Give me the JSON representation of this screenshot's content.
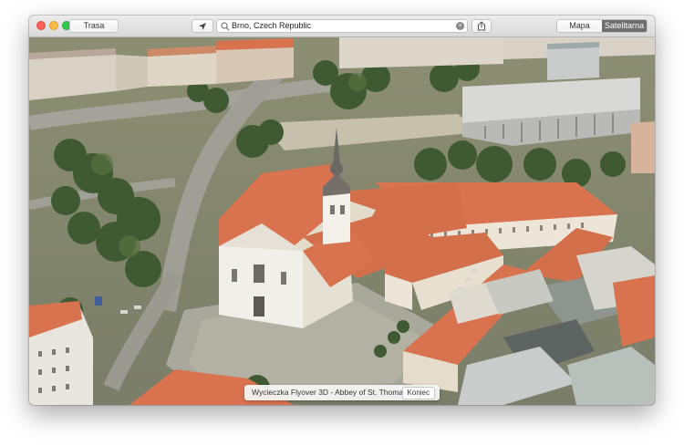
{
  "toolbar": {
    "route_label": "Trasa",
    "locate_icon": "location-arrow-icon",
    "search": {
      "value": "Brno, Czech Republic",
      "icon": "search-icon",
      "clear_icon": "clear-icon"
    },
    "share_icon": "share-icon",
    "view_modes": [
      {
        "label": "Mapa",
        "active": false
      },
      {
        "label": "Satelitarna",
        "active": true
      }
    ]
  },
  "flyover": {
    "label": "Wycieczka Flyover 3D - Abbey of St. Thomas",
    "end_label": "Koniec"
  },
  "colors": {
    "roof": "#d9734f",
    "selected_segment": "#6e6e6e"
  }
}
